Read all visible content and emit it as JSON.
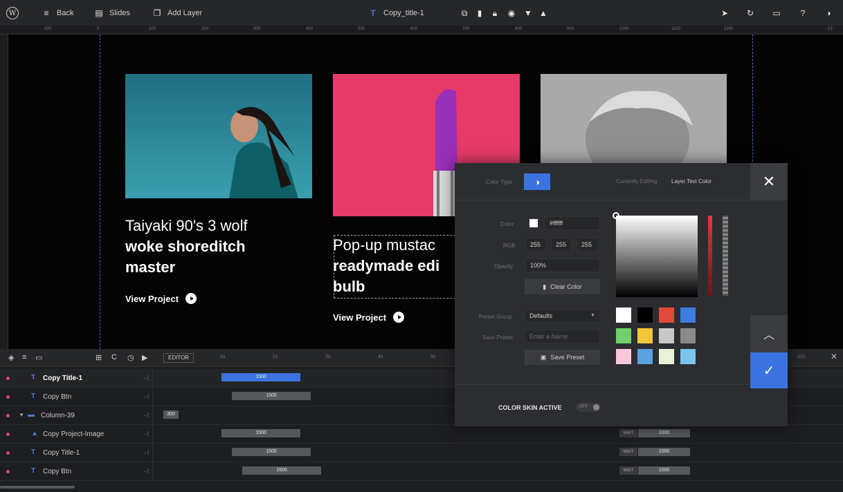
{
  "toolbar": {
    "back": "Back",
    "slides": "Slides",
    "add_layer": "Add Layer",
    "layer_name": "Copy_title-1"
  },
  "ruler": [
    "100",
    "0",
    "100",
    "200",
    "300",
    "400",
    "500",
    "600",
    "700",
    "800",
    "900",
    "1000",
    "1100",
    "1200",
    "13"
  ],
  "cards": [
    {
      "title_light": "Taiyaki 90's 3 wolf",
      "title_bold_1": "woke shoreditch",
      "title_bold_2": "master",
      "link": "View Project"
    },
    {
      "title_light": "Pop-up mustac",
      "title_bold_1": "readymade edi",
      "title_bold_2": "bulb",
      "link": "View Project"
    }
  ],
  "timeline": {
    "editor_label": "EDITOR",
    "time_ticks": [
      "1s",
      "2s",
      "3s",
      "4s",
      "5s",
      "12s"
    ],
    "rows": [
      {
        "name": "Copy Title-1",
        "icon": "T",
        "bar": "1500",
        "active": true
      },
      {
        "name": "Copy Btn",
        "icon": "T",
        "bar": "1500"
      },
      {
        "name": "Column-39",
        "icon": "▬",
        "bar": "300"
      },
      {
        "name": "Copy Project-Image",
        "icon": "▲",
        "bar": "1500",
        "wait": "WAIT",
        "wait_val": "1000"
      },
      {
        "name": "Copy Title-1",
        "icon": "T",
        "bar": "1500",
        "wait": "WAIT",
        "wait_val": "1000"
      },
      {
        "name": "Copy Btn",
        "icon": "T",
        "bar": "1500",
        "wait": "WAIT",
        "wait_val": "1000"
      }
    ]
  },
  "color_dialog": {
    "color_type_label": "Color Type",
    "currently_editing_label": "Currently Editing",
    "currently_editing_value": "Layer Text Color",
    "color_label": "Color",
    "hex_value": "#ffffff",
    "rgb_label": "RGB",
    "r": "255",
    "g": "255",
    "b": "255",
    "opacity_label": "Opacity",
    "opacity_value": "100%",
    "clear_color": "Clear Color",
    "preset_group_label": "Preset Group",
    "preset_group_value": "Defaults",
    "save_preset_label": "Save Preset",
    "save_preset_placeholder": "Enter a Name",
    "save_preset_button": "Save Preset",
    "color_skin_label": "COLOR SKIN ACTIVE",
    "color_skin_toggle": "OFF",
    "swatches": [
      "#ffffff",
      "#000000",
      "#e04a3a",
      "#3b7de0",
      "#6fcf6a",
      "#f2c53a",
      "#c8c8c8",
      "#8a8a8a",
      "#f6c8d8",
      "#5aa3e0",
      "#e8f2d6",
      "#7cc4ef"
    ]
  }
}
